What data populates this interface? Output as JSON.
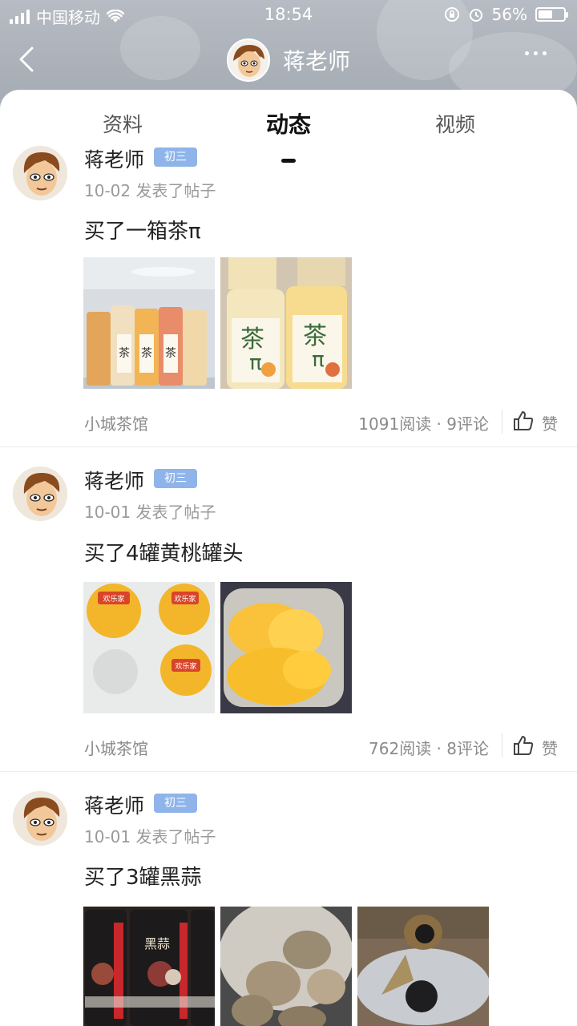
{
  "status_bar": {
    "carrier": "中国移动",
    "time": "18:54",
    "battery": "56%",
    "battery_level": 0.56
  },
  "navbar": {
    "title": "蒋老师"
  },
  "tabs": [
    {
      "label": "资料"
    },
    {
      "label": "动态"
    },
    {
      "label": "视频"
    }
  ],
  "posts": [
    {
      "author": "蒋老师",
      "grade": "初三",
      "meta": "10-02 发表了帖子",
      "content": "买了一箱茶π",
      "forum": "小城茶馆",
      "stats": "1091阅读 · 9评论",
      "like_label": "赞"
    },
    {
      "author": "蒋老师",
      "grade": "初三",
      "meta": "10-01 发表了帖子",
      "content": "买了4罐黄桃罐头",
      "forum": "小城茶馆",
      "stats": "762阅读 · 8评论",
      "like_label": "赞"
    },
    {
      "author": "蒋老师",
      "grade": "初三",
      "meta": "10-01 发表了帖子",
      "content": "买了3罐黑蒜"
    }
  ],
  "thumb_text": {
    "tea": "茶",
    "pi": "π",
    "brand": "欢乐家",
    "garlic": "黑蒜"
  },
  "colors": {
    "grade_badge": "#8fb4ea",
    "header": "#aab0b8"
  }
}
